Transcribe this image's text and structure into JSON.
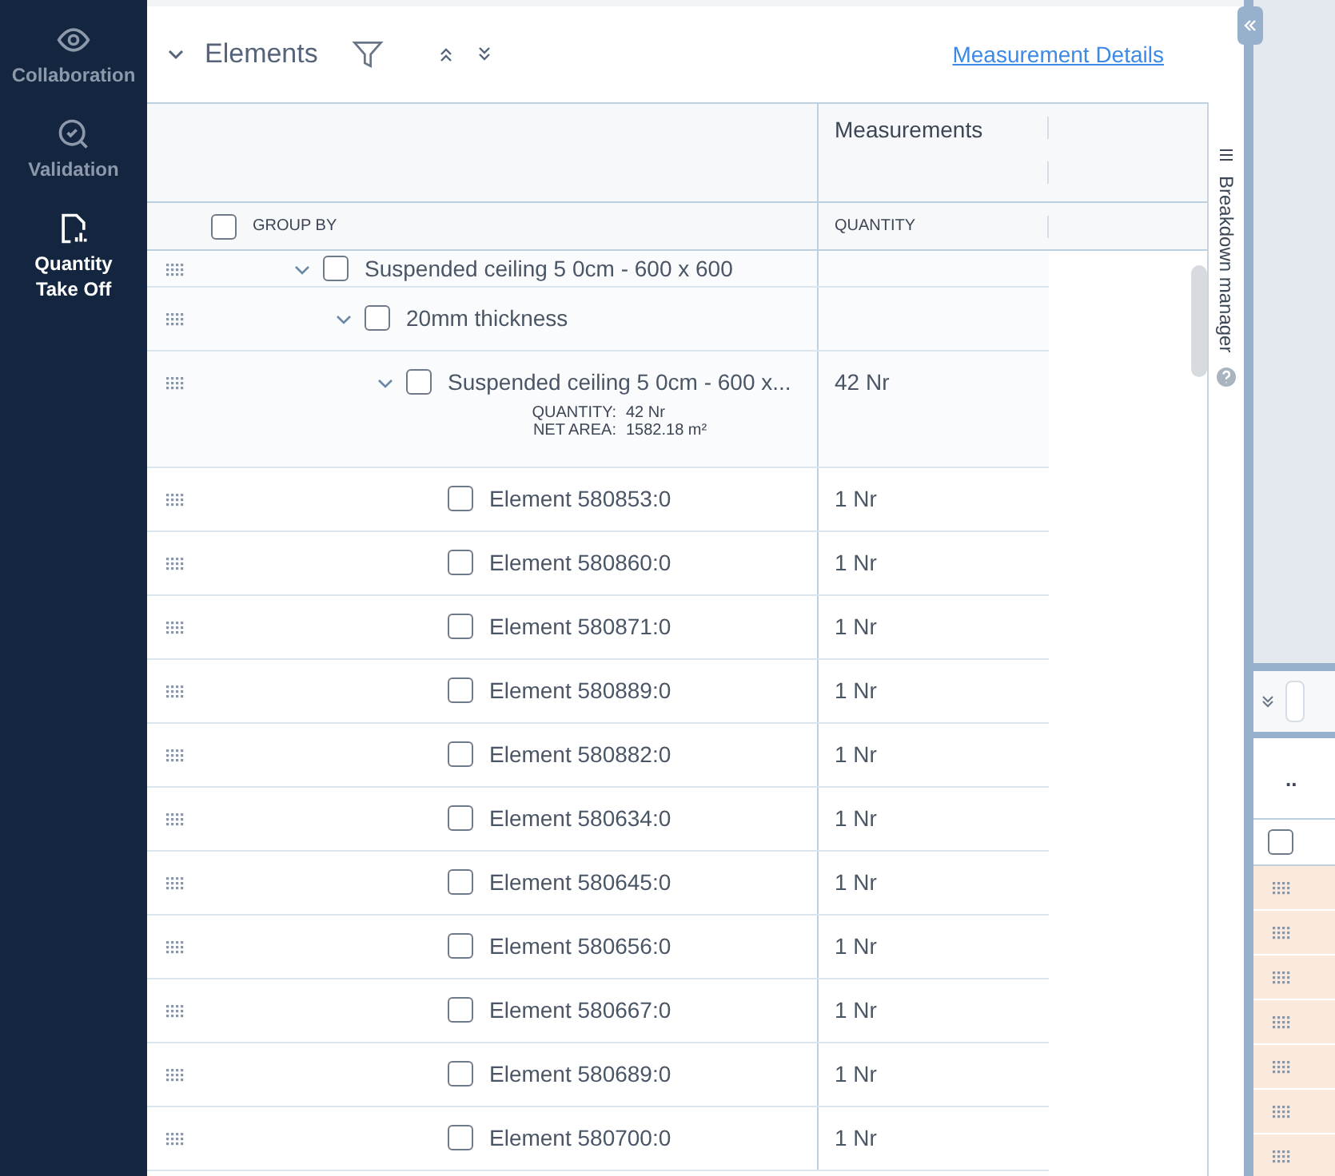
{
  "sidebar": [
    {
      "kind": "eye",
      "label": "Collaboration",
      "selected": false
    },
    {
      "kind": "search-check",
      "label": "Validation",
      "selected": false
    },
    {
      "kind": "document-chart",
      "label": "Quantity Take Off",
      "selected": true
    }
  ],
  "panel": {
    "title": "Elements",
    "link": "Measurement Details",
    "column_group": "Measurements",
    "group_by": {
      "label": "GROUP BY",
      "checked": false
    },
    "column_quantity": "QUANTITY"
  },
  "tree": [
    {
      "label": "Suspended ceiling 5 0cm - 600 x 600",
      "expanded": true,
      "checked": false,
      "children": [
        {
          "label": "20mm thickness",
          "expanded": true,
          "checked": false,
          "children": [
            {
              "label": "Suspended ceiling 5 0cm - 600 x...",
              "quantity": "42 Nr",
              "expanded": true,
              "checked": false,
              "details": [
                {
                  "label": "QUANTITY:",
                  "value": "42 Nr"
                },
                {
                  "label": "NET AREA:",
                  "value": "1582.18 m²"
                }
              ],
              "children": [
                {
                  "label": "Element 580853:0",
                  "quantity": "1 Nr",
                  "checked": false
                },
                {
                  "label": "Element 580860:0",
                  "quantity": "1 Nr",
                  "checked": false
                },
                {
                  "label": "Element 580871:0",
                  "quantity": "1 Nr",
                  "checked": false
                },
                {
                  "label": "Element 580889:0",
                  "quantity": "1 Nr",
                  "checked": false
                },
                {
                  "label": "Element 580882:0",
                  "quantity": "1 Nr",
                  "checked": false
                },
                {
                  "label": "Element 580634:0",
                  "quantity": "1 Nr",
                  "checked": false
                },
                {
                  "label": "Element 580645:0",
                  "quantity": "1 Nr",
                  "checked": false
                },
                {
                  "label": "Element 580656:0",
                  "quantity": "1 Nr",
                  "checked": false
                },
                {
                  "label": "Element 580667:0",
                  "quantity": "1 Nr",
                  "checked": false
                },
                {
                  "label": "Element 580689:0",
                  "quantity": "1 Nr",
                  "checked": false
                },
                {
                  "label": "Element 580700:0",
                  "quantity": "1 Nr",
                  "checked": false
                }
              ]
            }
          ]
        }
      ]
    }
  ],
  "side_tab": {
    "label": "Breakdown manager"
  },
  "lower_panel": {
    "label": "..",
    "header_checked": false,
    "rows": [
      {
        "highlighted": true
      },
      {
        "highlighted": true
      },
      {
        "highlighted": true
      },
      {
        "highlighted": true
      },
      {
        "highlighted": true
      },
      {
        "highlighted": true
      },
      {
        "highlighted": true
      }
    ]
  }
}
